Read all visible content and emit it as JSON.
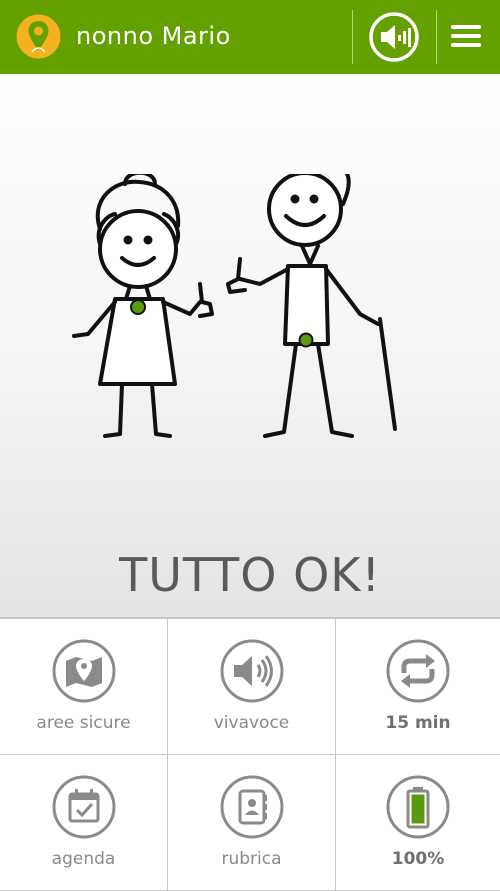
{
  "header": {
    "title": "nonno Mario",
    "logo_icon": "location-pin-icon",
    "speaker_icon": "speaker-icon",
    "menu_icon": "hamburger-menu-icon",
    "color": "#64a000"
  },
  "status": {
    "text": "TUTTO OK!",
    "illustration": "grandparents-thumbs-up-illustration",
    "tracker_color": "#5a9a10"
  },
  "tiles": [
    {
      "label": "aree sicure",
      "icon": "map-pin-icon"
    },
    {
      "label": "vivavoce",
      "icon": "speaker-icon"
    },
    {
      "label": "15 min",
      "icon": "refresh-arrows-icon"
    },
    {
      "label": "agenda",
      "icon": "calendar-check-icon"
    },
    {
      "label": "rubrica",
      "icon": "contacts-book-icon"
    },
    {
      "label": "100%",
      "icon": "battery-icon",
      "level": 1.0
    }
  ]
}
